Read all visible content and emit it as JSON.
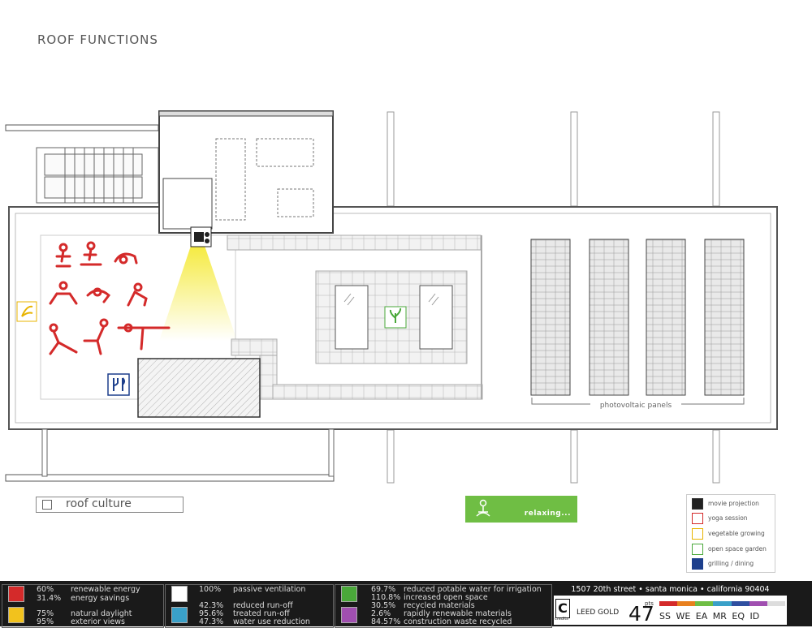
{
  "title": "ROOF FUNCTIONS",
  "plan": {
    "pv_label": "photovoltaic panels"
  },
  "roof_label": "roof culture",
  "relax_label": "relaxing...",
  "legend": [
    {
      "icon": "movie-projection-icon",
      "label": "movie projection",
      "color": "#222222"
    },
    {
      "icon": "yoga-icon",
      "label": "yoga session",
      "color": "#d42a2a"
    },
    {
      "icon": "vegetable-icon",
      "label": "vegetable growing",
      "color": "#e8b400"
    },
    {
      "icon": "garden-icon",
      "label": "open space garden",
      "color": "#4aa83a"
    },
    {
      "icon": "dining-icon",
      "label": "grilling / dining",
      "color": "#1d3f8c"
    }
  ],
  "stats": {
    "energy": [
      {
        "value": "60%",
        "text": "renewable energy"
      },
      {
        "value": "31.4%",
        "text": "energy savings"
      },
      {
        "value": "75%",
        "text": "natural daylight"
      },
      {
        "value": "95%",
        "text": "exterior views"
      }
    ],
    "water": [
      {
        "value": "100%",
        "text": "passive ventilation"
      },
      {
        "value": "42.3%",
        "text": "reduced run-off"
      },
      {
        "value": "95.6%",
        "text": "treated run-off"
      },
      {
        "value": "47.3%",
        "text": "water use reduction"
      }
    ],
    "materials": [
      {
        "value": "69.7%",
        "text": "reduced potable water for irrigation"
      },
      {
        "value": "110.8%",
        "text": "increased open space"
      },
      {
        "value": "30.5%",
        "text": "recycled materials"
      },
      {
        "value": "2.6%",
        "text": "rapidly renewable materials"
      },
      {
        "value": "84.57%",
        "text": "construction waste recycled"
      }
    ]
  },
  "info": {
    "address": "1507 20th street • santa monica • california 90404",
    "c": "C",
    "credits": "credits",
    "leed": "LEED GOLD",
    "points": "47",
    "points_label": "pts",
    "categories": "SS WE EA MR EQ ID",
    "bar_colors": [
      "#d42a2a",
      "#e8801e",
      "#6fbe44",
      "#3aa0c8",
      "#2f4fa0",
      "#a04fb0",
      "#dddddd"
    ]
  },
  "colors": {
    "accent_green": "#6fbe44",
    "yoga_red": "#d42a2a",
    "light_cone": "#f5ea3c"
  }
}
